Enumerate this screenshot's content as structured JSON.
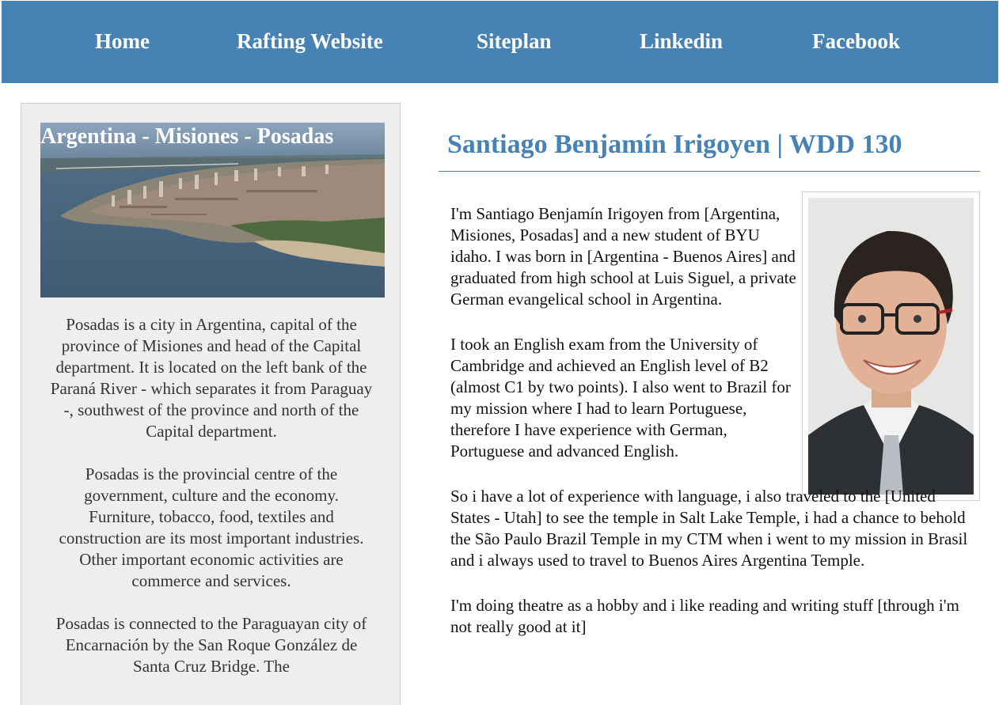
{
  "nav": {
    "items": [
      {
        "label": "Home"
      },
      {
        "label": "Rafting Website"
      },
      {
        "label": "Siteplan"
      },
      {
        "label": "Linkedin"
      },
      {
        "label": "Facebook"
      }
    ]
  },
  "sidebar": {
    "photo_caption": "Argentina - Misiones - Posadas",
    "paragraphs": [
      "Posadas is a city in Argentina, capital of the province of Misiones and head of the Capital department. It is located on the left bank of the Paraná River - which separates it from Paraguay -, southwest of the province and north of the Capital department.",
      "Posadas is the provincial centre of the government, culture and the economy. Furniture, tobacco, food, textiles and construction are its most important industries. Other important economic activities are commerce and services.",
      "Posadas is connected to the Paraguayan city of Encarnación by the San Roque González de Santa Cruz Bridge. The"
    ]
  },
  "main": {
    "title": "Santiago Benjamín Irigoyen | WDD 130",
    "paragraphs": [
      "I'm Santiago Benjamín Irigoyen from [Argentina, Misiones, Posadas] and a new student of BYU idaho. I was born in [Argentina - Buenos Aires] and graduated from high school at Luis Siguel, a private German evangelical school in Argentina.",
      "I took an English exam from the University of Cambridge and achieved an English level of B2 (almost C1 by two points). I also went to Brazil for my mission where I had to learn Portuguese, therefore I have experience with German, Portuguese and advanced English.",
      "So i have a lot of experience with language, i also traveled to the [United States - Utah] to see the temple in Salt Lake Temple, i had a chance to behold the São Paulo Brazil Temple in my CTM when i went to my mission in Brasil and i always used to travel to Buenos Aires Argentina Temple.",
      "I'm doing theatre as a hobby and i like reading and writing stuff [through i'm not really good at it]"
    ]
  },
  "colors": {
    "nav_bg": "#4682b4",
    "accent": "#4682b4",
    "sidebar_bg": "#eeeeee"
  }
}
